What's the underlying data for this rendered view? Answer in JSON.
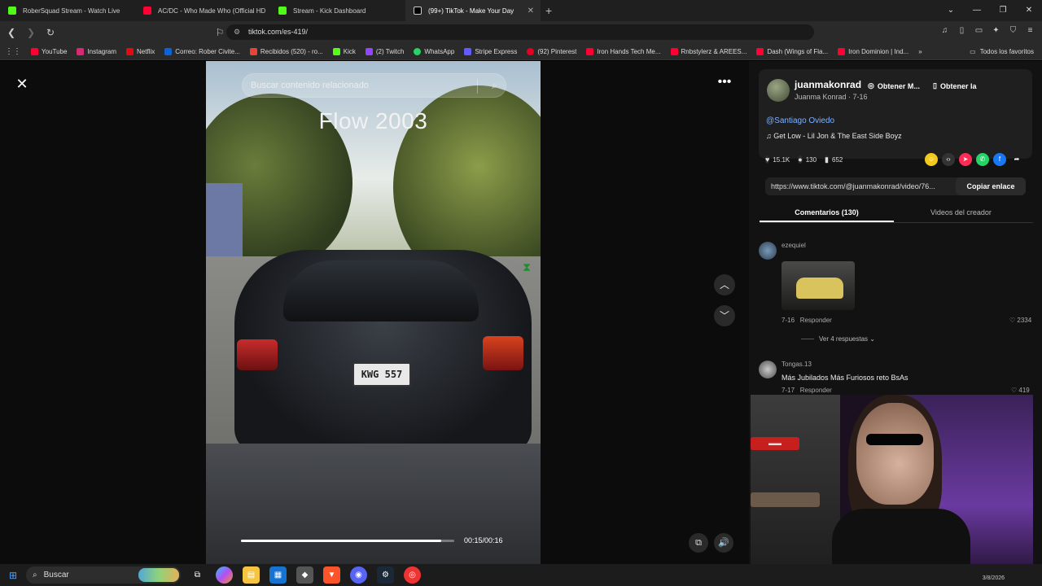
{
  "tabs": [
    {
      "title": "RoberSquad Stream - Watch Live",
      "color": "#53fc18"
    },
    {
      "title": "AC/DC - Who Made Who (Official HD",
      "color": "#ff0033"
    },
    {
      "title": "Stream - Kick Dashboard",
      "color": "#53fc18"
    },
    {
      "title": "(99+) TikTok - Make Your Day",
      "color": "#ffffff",
      "active": true
    }
  ],
  "address": {
    "url": "tiktok.com/es-419/"
  },
  "bookmarks": [
    {
      "label": "YouTube",
      "color": "#ff0033"
    },
    {
      "label": "Instagram",
      "color": "#d62976"
    },
    {
      "label": "Netflix",
      "color": "#e50914"
    },
    {
      "label": "Correo: Rober Civite...",
      "color": "#0a64d6"
    },
    {
      "label": "Recibidos (520) - ro...",
      "color": "#ea4335"
    },
    {
      "label": "Kick",
      "color": "#53fc18"
    },
    {
      "label": "(2) Twitch",
      "color": "#9146ff"
    },
    {
      "label": "WhatsApp",
      "color": "#25d366"
    },
    {
      "label": "Stripe Express",
      "color": "#635bff"
    },
    {
      "label": "(92) Pinterest",
      "color": "#e60023"
    },
    {
      "label": "Iron Hands Tech Me...",
      "color": "#ff0033"
    },
    {
      "label": "Rnbstylerz & AREES...",
      "color": "#ff0033"
    },
    {
      "label": "Dash (Wings of Fla...",
      "color": "#ff0033"
    },
    {
      "label": "Iron Dominion | Ind...",
      "color": "#ff0033"
    }
  ],
  "bookmarks_all": "Todos los favoritos",
  "video": {
    "search_placeholder": "Buscar contenido relacionado",
    "overlay_text": "Flow 2003",
    "plate": "KWG 557",
    "time": "00:15/00:16",
    "progress": 0.94
  },
  "creator": {
    "handle": "juanmakonrad",
    "name_date": "Juanma Konrad · 7-16",
    "get_app_1": "Obtener M...",
    "get_app_2": "Obtener la",
    "mention": "@Santiago Oviedo",
    "song": "Get Low - Lil Jon & The East Side Boyz",
    "likes": "15.1K",
    "comments": "130",
    "saves": "652",
    "link": "https://www.tiktok.com/@juanmakonrad/video/76...",
    "copy_label": "Copiar enlace"
  },
  "panel_tabs": {
    "comments": "Comentarios (130)",
    "videos": "Videos del creador"
  },
  "comments": [
    {
      "user": "ezequiel",
      "date": "7-16",
      "reply": "Responder",
      "likes": "2334",
      "more_replies": "Ver 4 respuestas"
    },
    {
      "user": "Tongas.13",
      "text": "Más Jubilados Más Furiosos reto BsAs",
      "date": "7-17",
      "reply": "Responder",
      "likes": "419"
    }
  ],
  "taskbar": {
    "search_label": "Buscar",
    "clock": "3/8/2026"
  }
}
